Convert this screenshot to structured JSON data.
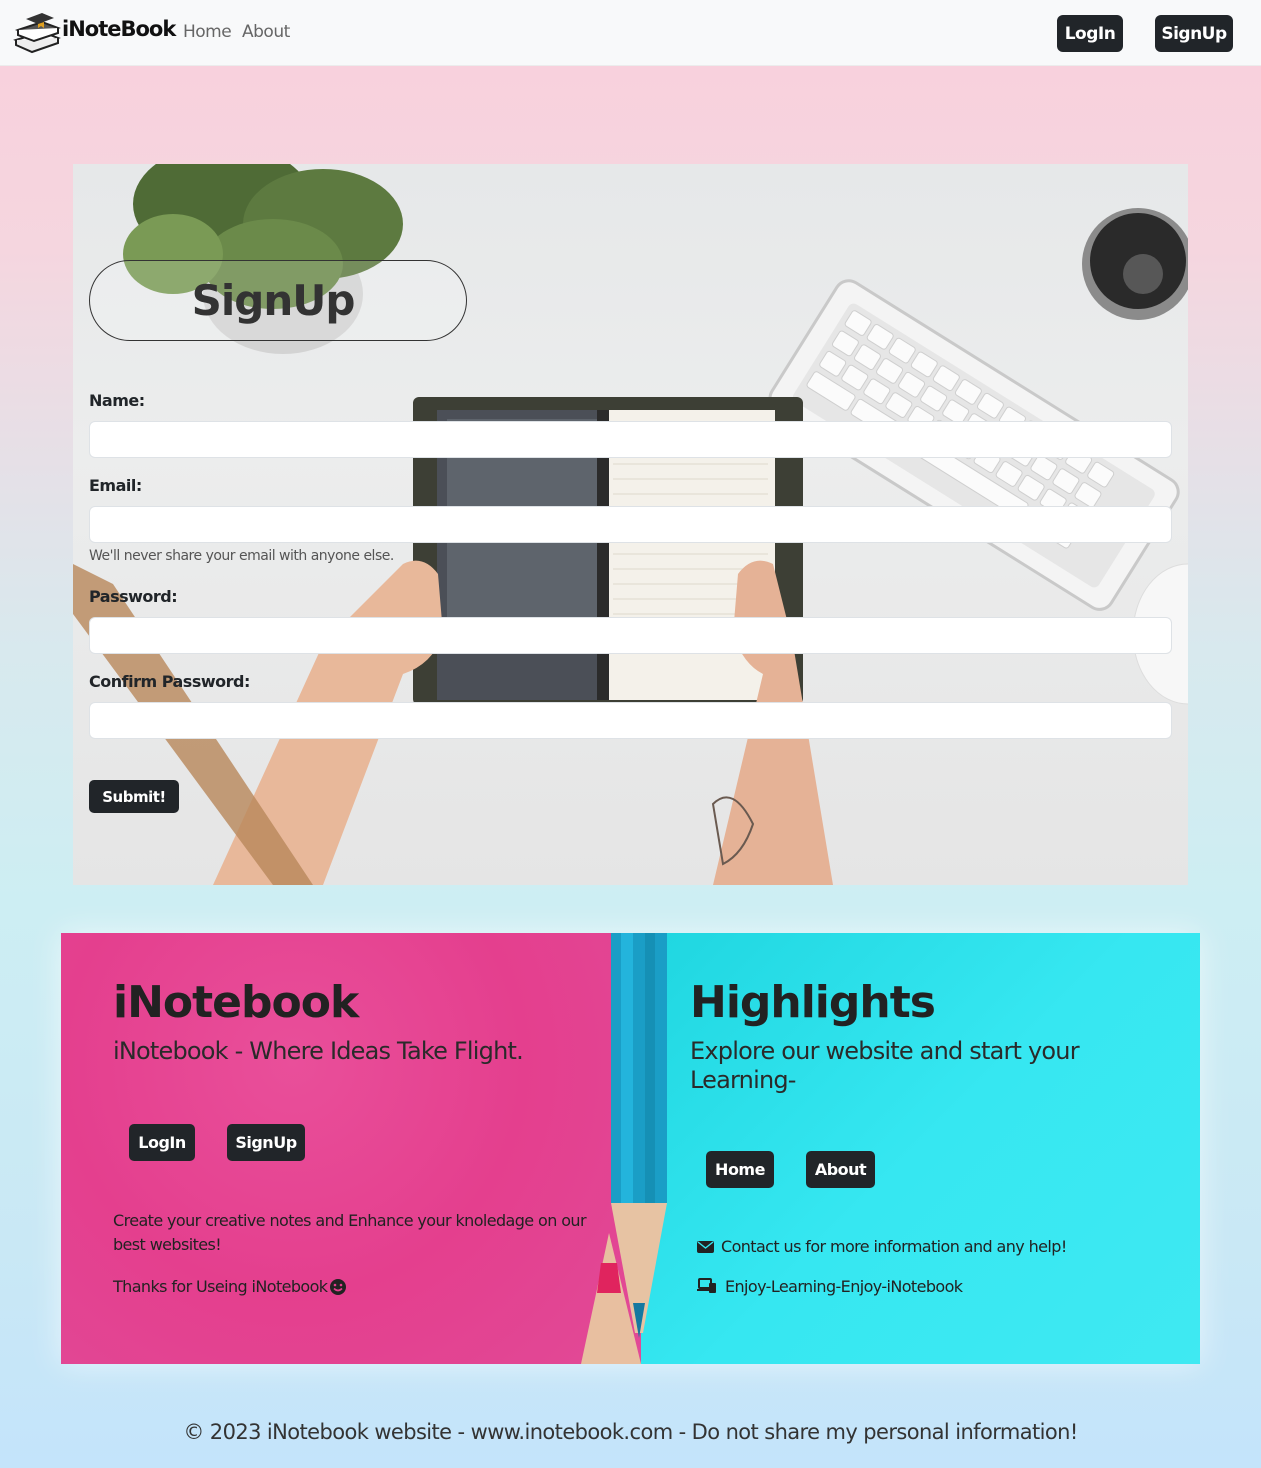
{
  "navbar": {
    "brand": "iNoteBook",
    "links": [
      "Home",
      "About"
    ],
    "login_label": "LogIn",
    "signup_label": "SignUp"
  },
  "signup_form": {
    "title": "SignUp",
    "name_label": "Name:",
    "email_label": "Email:",
    "email_help": "We'll never share your email with anyone else.",
    "password_label": "Password:",
    "confirm_password_label": "Confirm Password:",
    "submit_label": "Submit!"
  },
  "footer": {
    "left": {
      "title": "iNotebook",
      "tagline": "iNotebook - Where Ideas Take Flight.",
      "login_label": "LogIn",
      "signup_label": "SignUp",
      "description": "Create your creative notes and Enhance your knoledage on our best websites!",
      "thanks": "Thanks for Useing iNotebook",
      "thanks_icon": "smile-icon"
    },
    "right": {
      "title": "Highlights",
      "tagline": "Explore our website and start your Learning-",
      "home_label": "Home",
      "about_label": "About",
      "contact_text": "Contact us for more information and any help!",
      "contact_icon": "envelope-icon",
      "enjoy_text": "Enjoy-Learning-Enjoy-iNotebook",
      "enjoy_icon": "devices-icon"
    }
  },
  "copyright": "© 2023 iNotebook website - www.inotebook.com - Do not share my personal information!",
  "colors": {
    "button_dark": "#212529",
    "pink_panel": "#e43f8e",
    "cyan_panel": "#36e7f1",
    "navbar_bg": "#f8f9fa"
  }
}
